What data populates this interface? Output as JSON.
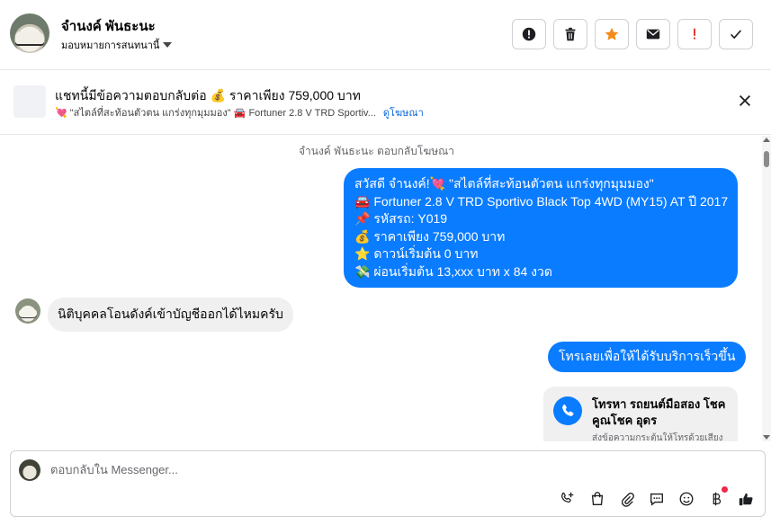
{
  "header": {
    "contact_name": "จำนงค์ พันธะนะ",
    "label_select": "มอบหมายการสนทนานี้",
    "actions": [
      "spam-icon",
      "trash-icon",
      "star-icon",
      "envelope-icon",
      "important-icon",
      "checkmark-icon"
    ],
    "colors": {
      "star": "#f28b1b",
      "important": "#e02424"
    }
  },
  "ad_bar": {
    "title": "แชทนี้มีข้อความตอบกลับต่อ 💰 ราคาเพียง 759,000 บาท",
    "subtitle": "💘 \"สไตล์ที่สะท้อนตัวตน แกร่งทุกมุมมอง\" 🚘 Fortuner 2.8 V TRD Sportiv...",
    "link": "ดูโฆษณา"
  },
  "thread": {
    "system_note": "จำนงค์ พันธะนะ ตอบกลับโฆษณา",
    "msg1": {
      "line1": "สวัสดี จำนงค์!💘 \"สไตล์ที่สะท้อนตัวตน แกร่งทุกมุมมอง\"",
      "line2": "🚘  Fortuner 2.8 V TRD Sportivo Black Top 4WD (MY15) AT ปี 2017",
      "line3": "📌 รหัสรถ: Y019",
      "line4": "💰 ราคาเพียง 759,000 บาท",
      "line5": "⭐ ดาวน์เริ่มต้น 0 บาท",
      "line6": "💸 ผ่อนเริ่มต้น 13,xxx บาท x 84 งวด"
    },
    "msg2": "นิติบุคคลโอนดังค์เข้าบัญชีออกได้ไหมครับ",
    "msg3": "โทรเลยเพื่อให้ได้รับบริการเร็วขึ้น",
    "call_card": {
      "title": "โทรหา รถยนต์มือสอง โชคคูณโชค อุดร",
      "subtitle": "ส่งข้อความกระตุ้นให้โทรด้วยเสียง"
    },
    "bubble_color": "#0a7cff"
  },
  "composer": {
    "placeholder": "ตอบกลับใน Messenger...",
    "tools": [
      "phone-plus-icon",
      "shopping-bag-icon",
      "paperclip-icon",
      "chat-reply-icon",
      "emoji-icon",
      "baht-icon",
      "like-icon"
    ],
    "notification_dot_color": "#f02849"
  }
}
